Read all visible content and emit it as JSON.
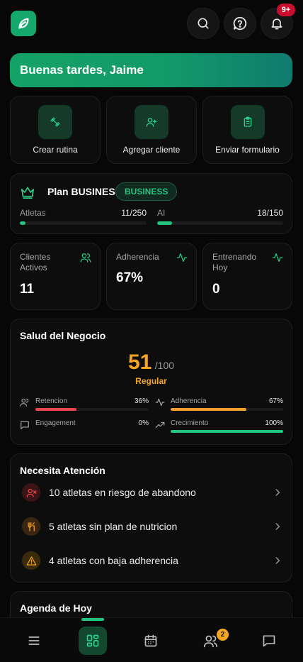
{
  "header": {
    "logo_icon": "leaf-logo-icon",
    "notifications_badge": "9+"
  },
  "greeting": "Buenas tardes, Jaime",
  "quick_actions": [
    {
      "label": "Crear rutina",
      "icon": "dumbbell-icon"
    },
    {
      "label": "Agregar cliente",
      "icon": "user-plus-icon"
    },
    {
      "label": "Enviar formulario",
      "icon": "clipboard-icon"
    }
  ],
  "plan": {
    "title": "Plan BUSINESS",
    "badge": "BUSINESS",
    "athletes_label": "Atletas",
    "athletes_value": "11/250",
    "athletes_fraction": 0.044,
    "ai_label": "AI",
    "ai_value": "18/150",
    "ai_fraction": 0.12
  },
  "stats": [
    {
      "label": "Clientes Activos",
      "value": "11",
      "icon": "users-icon"
    },
    {
      "label": "Adherencia",
      "value": "67%",
      "icon": "activity-icon"
    },
    {
      "label": "Entrenando Hoy",
      "value": "0",
      "icon": "activity-icon"
    }
  ],
  "health": {
    "title": "Salud del Negocio",
    "score": "51",
    "score_max": "/100",
    "grade": "Regular",
    "metrics": [
      {
        "label": "Retencion",
        "value": "36%",
        "fraction": 0.36,
        "color": "#e5484d",
        "icon": "users-icon"
      },
      {
        "label": "Adherencia",
        "value": "67%",
        "fraction": 0.67,
        "color": "#f59e2b",
        "icon": "activity-icon"
      },
      {
        "label": "Engagement",
        "value": "0%",
        "fraction": 0.0,
        "color": "#6b7280",
        "icon": "message-icon"
      },
      {
        "label": "Crecimiento",
        "value": "100%",
        "fraction": 1.0,
        "color": "#22c47f",
        "icon": "trending-up-icon"
      }
    ]
  },
  "attention": {
    "title": "Necesita Atención",
    "items": [
      {
        "text": "10 atletas en riesgo de abandono",
        "icon": "user-x-icon",
        "color": "#e5484d"
      },
      {
        "text": "5 atletas sin plan de nutricion",
        "icon": "utensils-icon",
        "color": "#f59e2b"
      },
      {
        "text": "4 atletas con baja adherencia",
        "icon": "warning-icon",
        "color": "#f4a623"
      }
    ]
  },
  "agenda": {
    "title": "Agenda de Hoy"
  },
  "nav": {
    "clients_badge": "2"
  },
  "colors": {
    "accent": "#22c47f",
    "warning": "#f4a623",
    "danger": "#e5484d"
  }
}
